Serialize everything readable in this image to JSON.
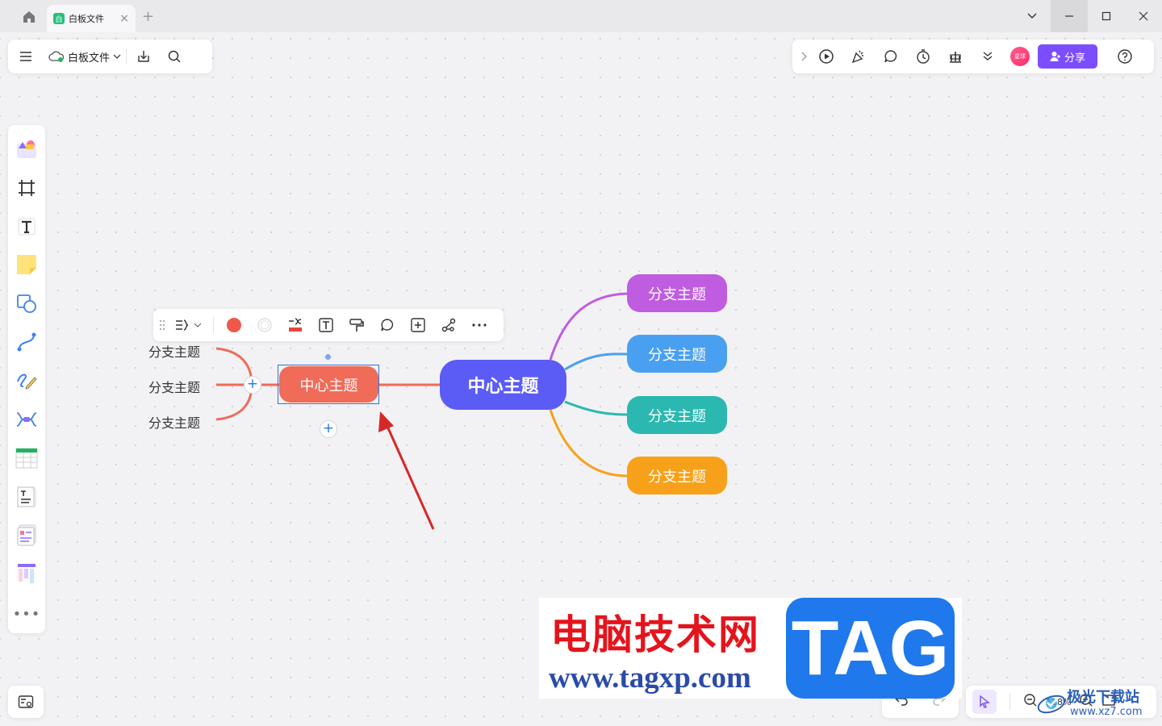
{
  "titlebar": {
    "tab_label": "白板文件",
    "tab_logo": "白"
  },
  "toolbar_left": {
    "file_name": "白板文件"
  },
  "toolbar_right": {
    "avatar_text": "星球",
    "share_label": "分享"
  },
  "zoom": {
    "value": "118%"
  },
  "mindmap": {
    "center_main": "中心主题",
    "branches": [
      "分支主题",
      "分支主题",
      "分支主题",
      "分支主题"
    ],
    "selected_node": "中心主题",
    "left_branches": [
      "分支主题",
      "分支主题",
      "分支主题"
    ]
  },
  "colors": {
    "accent": "#7c4dff",
    "center_node": "#5b5bf5",
    "branch_purple": "#c05cdf",
    "branch_blue": "#4aa0f0",
    "branch_teal": "#2bb8b0",
    "branch_orange": "#f7a11a",
    "selected_node": "#f06b58",
    "arrow": "#d62828"
  },
  "watermark": {
    "title": "电脑技术网",
    "url": "www.tagxp.com",
    "tag": "TAG",
    "site2_name": "极光下载站",
    "site2_url": "www.xz7.com"
  }
}
